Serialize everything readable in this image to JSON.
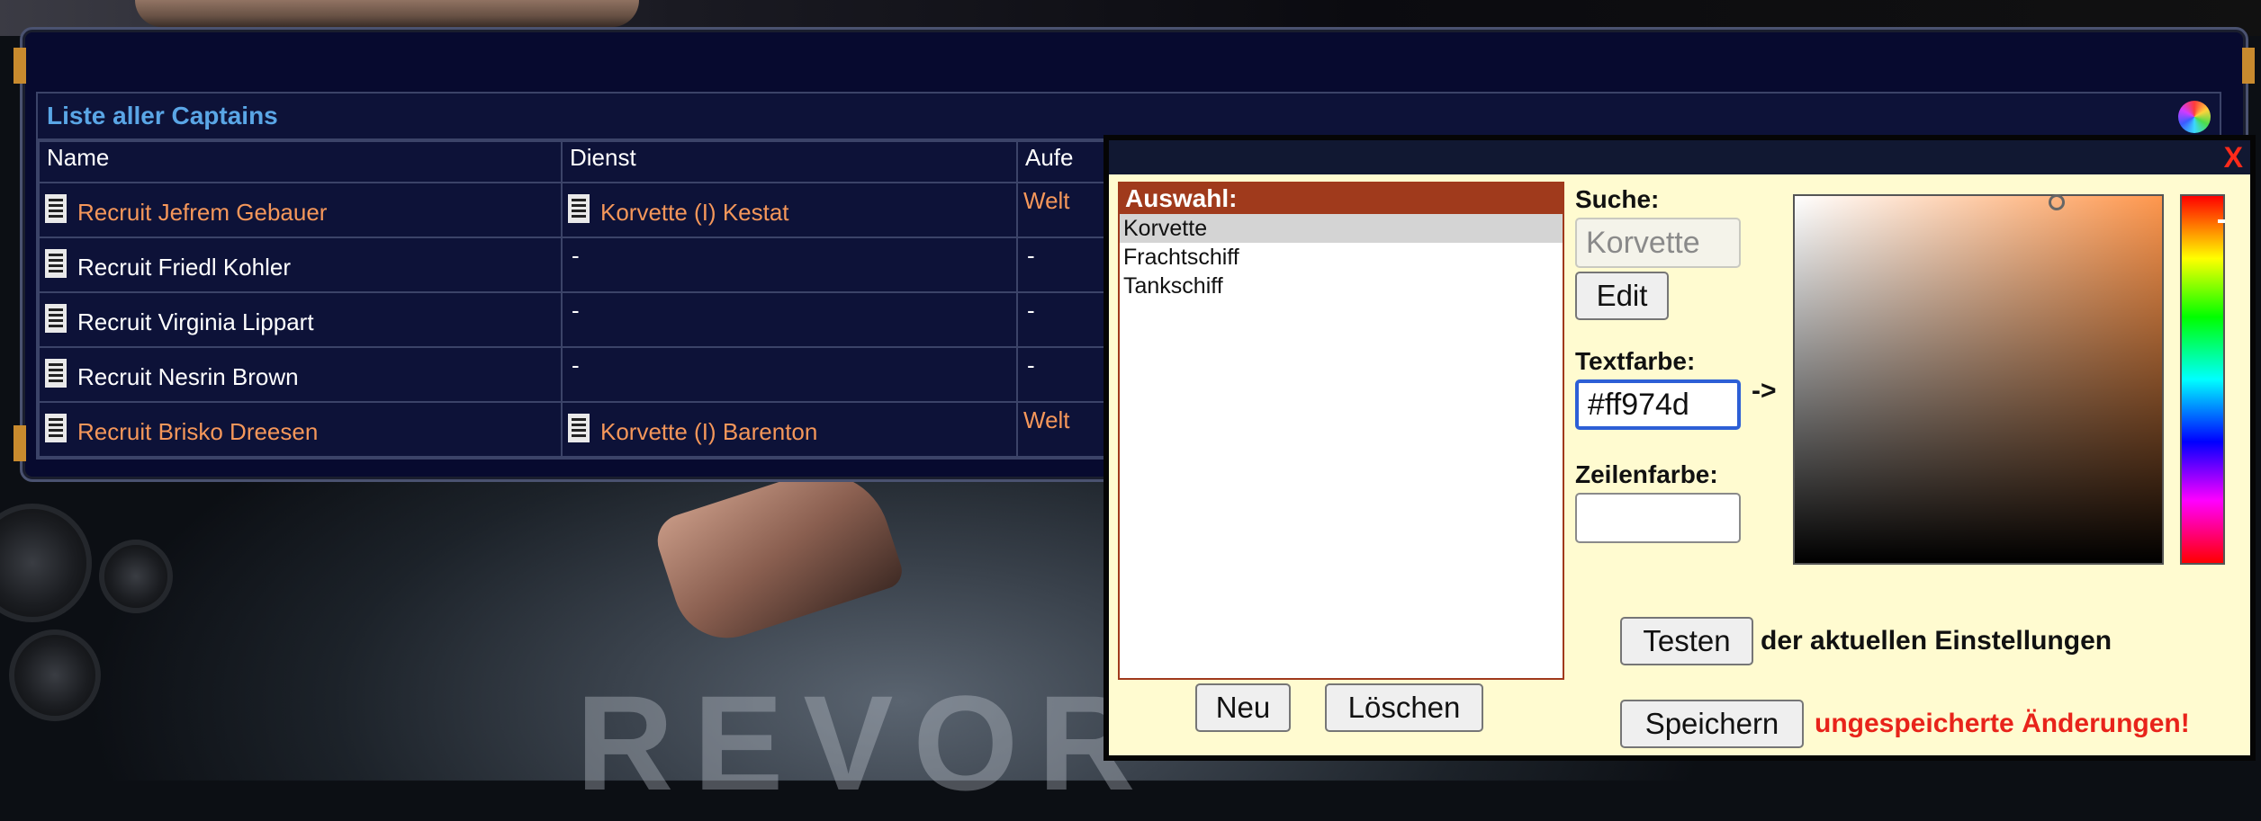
{
  "background": {
    "watermark": "REVOR"
  },
  "captains": {
    "title": "Liste aller Captains",
    "columns": [
      "Name",
      "Dienst",
      "Aufe"
    ],
    "rows": [
      {
        "name": "Recruit Jefrem Gebauer",
        "dienst": "Korvette (I) Kestat",
        "aufe": "Welt",
        "highlight": true
      },
      {
        "name": "Recruit Friedl Kohler",
        "dienst": "-",
        "aufe": "-",
        "highlight": false
      },
      {
        "name": "Recruit Virginia Lippart",
        "dienst": "-",
        "aufe": "-",
        "highlight": false
      },
      {
        "name": "Recruit Nesrin Brown",
        "dienst": "-",
        "aufe": "-",
        "highlight": false
      },
      {
        "name": "Recruit Brisko Dreesen",
        "dienst": "Korvette (I) Barenton",
        "aufe": "Welt",
        "highlight": true
      }
    ],
    "highlight_color": "#ff974d"
  },
  "editor": {
    "close_label": "X",
    "select_header": "Auswahl:",
    "options": [
      "Korvette",
      "Frachtschiff",
      "Tankschiff"
    ],
    "selected_option": "Korvette",
    "new_label": "Neu",
    "delete_label": "Löschen",
    "search_label": "Suche:",
    "search_value": "Korvette",
    "edit_label": "Edit",
    "textcolor_label": "Textfarbe:",
    "textcolor_value": "#ff974d",
    "arrow": "->",
    "rowcolor_label": "Zeilenfarbe:",
    "rowcolor_value": "",
    "test_label": "Testen",
    "test_suffix": "der aktuellen Einstellungen",
    "save_label": "Speichern",
    "unsaved_message": "ungespeicherte Änderungen!",
    "unsaved_color": "#e8231a"
  }
}
